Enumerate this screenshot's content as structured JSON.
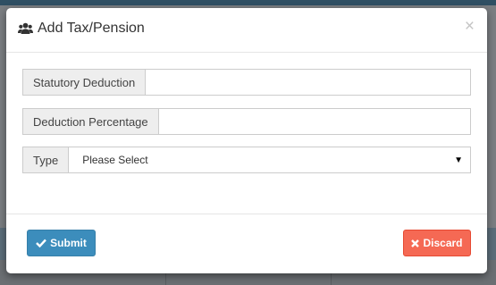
{
  "modal": {
    "title": "Add Tax/Pension",
    "title_icon": "users-icon",
    "close_symbol": "×"
  },
  "form": {
    "statutory_deduction": {
      "label": "Statutory Deduction",
      "value": ""
    },
    "deduction_percentage": {
      "label": "Deduction Percentage",
      "value": ""
    },
    "type": {
      "label": "Type",
      "selected": "Please Select"
    }
  },
  "footer": {
    "submit_label": "Submit",
    "submit_icon": "check-icon",
    "discard_label": "Discard",
    "discard_icon": "times-icon"
  },
  "colors": {
    "submit": "#3c8dbc",
    "discard": "#f56954"
  }
}
